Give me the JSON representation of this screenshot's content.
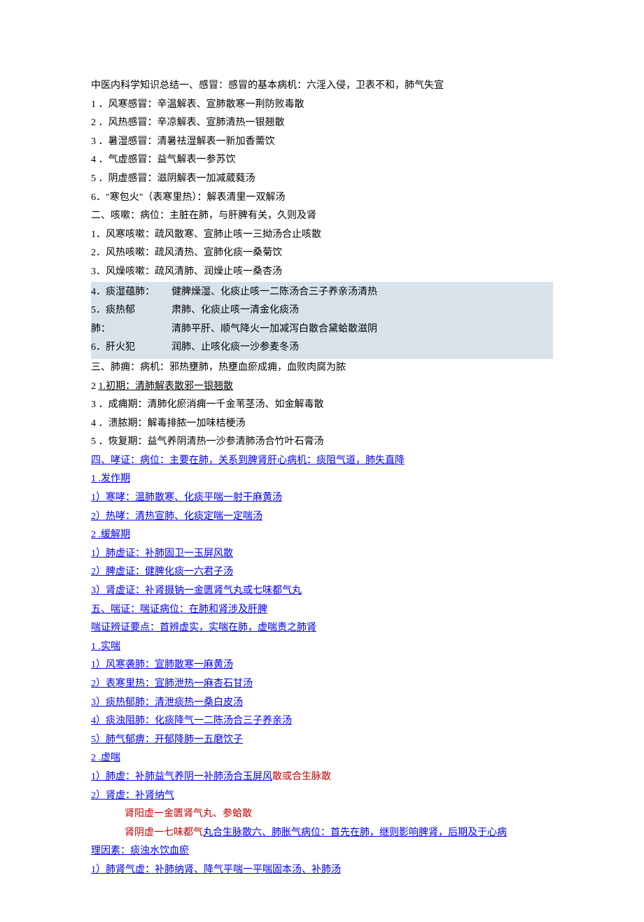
{
  "lines": {
    "l1": "中医内科学知识总结一、感冒：感冒的基本病机：六淫入侵，卫表不和，肺气失宣",
    "l2": "1 ．风寒感冒：辛温解表、宣肺散寒一荆防败毒散",
    "l3": "2 ．风热感冒：辛凉解表、宣肺清热一银翘散",
    "l4": "3 ．暑湿感冒：清暑祛湿解表一新加香薷饮",
    "l5": "4 ．气虚感冒：益气解表一参苏饮",
    "l6": "5 ．阴虚感冒：滋阴解表一加减葳蕤汤",
    "l7": "6．\"寒包火\"（表寒里热）：解表清里一双解汤",
    "l8": "二、咳嗽：病位：主脏在肺，与肝脾有关，久则及肾",
    "l9": "1．风寒咳嗽：疏风散寒、宣肺止咳一三拗汤合止咳散",
    "l10": "2．风热咳嗽：疏风清热、宣肺化痰一桑菊饮",
    "l11": "3．风燥咳嗽：疏风清肺、润燥止咳一桑杏汤"
  },
  "highlight": {
    "left1": "4．痰湿蕴肺：",
    "left2": "5．痰热郁",
    "left3": "肺：",
    "left4": "6．肝火犯",
    "right1": "健脾燥湿、化痰止咳一二陈汤合三子养亲汤清热",
    "right2": "肃肺、化痰止咳一清金化痰汤",
    "right3": "清肺平肝、顺气降火一加减泻白散合黛蛤散滋阴",
    "right4": "润肺、止咳化痰一沙参麦冬汤"
  },
  "lines2": {
    "l12": "三、肺痈：病机：邪热壅肺，热壅血瘀成痈，血败肉腐为脓",
    "l13a": "2 ",
    "l13b": "1.初期：清肺解表散邪一银翘散",
    "l14": "3 ．成痈期：清肺化瘀消痈一千金苇茎汤、如金解毒散",
    "l15": "4 ．溃脓期：解毒排脓一加味桔梗汤",
    "l16": "5 ．恢复期：益气养阴清热一沙参清肺汤合竹叶石膏汤"
  },
  "links": {
    "k1": "四、哮证：病位：主要在肺，关系到脾肾肝心病机：痰阻气道，肺失直降",
    "k2a": "1",
    "k2b": " .发作期",
    "k3": "1）寒哮：温肺散寒、化痰平喘一射干麻黄汤",
    "k4": "2）热哮：清热宣肺、化痰定喘一定喘汤",
    "k5a": "2",
    "k5b": " .缓解期",
    "k6": "1）肺虚证：补肺固卫一玉屏风散",
    "k7": "2）脾虚证：健脾化痰一六君子汤",
    "k8": "3）肾虚证：补肾摄钠一金匮肾气丸或七味都气丸",
    "k9": "五、喘证：喘证病位：在肺和肾涉及肝脾",
    "k10": "喘证辨证要点：首辨虚实，实喘在肺，虚喘责之肺肾",
    "k11a": "1",
    "k11b": " .实喘",
    "k12": "1）风寒袭肺：宣肺散寒一麻黄汤",
    "k13": "2）表寒里热：宣肺泄热一麻杏石甘汤",
    "k14": "3）痰热郁肺：清泄痰热一桑白皮汤",
    "k15": "4）痰浊阻肺：化痰降气一二陈汤合三子养亲汤",
    "k16": "5）肺气郁痹：开郁降肺一五磨饮子",
    "k17a": "2",
    "k17b": " .虚喘",
    "k18a": "1）肺虚：补肺益气养阴一补肺汤合玉屏风",
    "k18b": "散或合生脉散",
    "k19": "2）肾虚：补肾纳气",
    "k20": "肾阳虚一金匮肾气丸、参蛤散",
    "k21a": "肾阴虚一七味都气",
    "k21b": "丸合生脉散六、肺胀气病位：首先在肺，继则影响脾肾，后期及于心病",
    "k22": "理因素：痰浊水饮血瘀",
    "k23": "1）肺肾气虚：补肺纳肾、降气平喘一平喘固本汤、补肺汤"
  }
}
